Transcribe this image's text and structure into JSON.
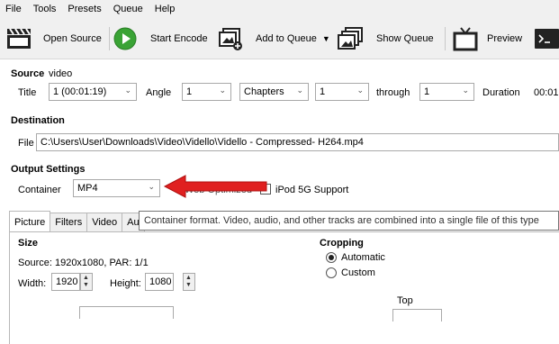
{
  "menu": [
    "File",
    "Tools",
    "Presets",
    "Queue",
    "Help"
  ],
  "toolbar": {
    "open_source": "Open Source",
    "start_encode": "Start Encode",
    "add_to_queue": "Add to Queue",
    "show_queue": "Show Queue",
    "preview": "Preview"
  },
  "source": {
    "label": "Source",
    "name": "video",
    "title_label": "Title",
    "title_value": "1 (00:01:19)",
    "angle_label": "Angle",
    "angle_value": "1",
    "chapters_value": "Chapters",
    "chapter_start": "1",
    "through_label": "through",
    "chapter_end": "1",
    "duration_label": "Duration",
    "duration_value": "00:01"
  },
  "destination": {
    "label": "Destination",
    "file_label": "File",
    "file_value": "C:\\Users\\User\\Downloads\\Video\\Vidello\\Vidello - Compressed- H264.mp4"
  },
  "output": {
    "label": "Output Settings",
    "container_label": "Container",
    "container_value": "MP4",
    "web_optimized": "Web Optimized",
    "ipod_support": "iPod 5G Support"
  },
  "tabs": [
    "Picture",
    "Filters",
    "Video",
    "Au"
  ],
  "tooltip": "Container format. Video, audio, and other tracks are combined into a single file of this type",
  "picture": {
    "size_label": "Size",
    "source_info": "Source:  1920x1080, PAR: 1/1",
    "width_label": "Width:",
    "width_value": "1920",
    "height_label": "Height:",
    "height_value": "1080",
    "cropping_label": "Cropping",
    "automatic": "Automatic",
    "custom": "Custom",
    "top_label": "Top"
  },
  "colors": {
    "play_green": "#3aa335",
    "arrow_red": "#e02020"
  },
  "icons": [
    "clapperboard-icon",
    "play-icon",
    "add-queue-icon",
    "show-queue-icon",
    "tv-icon",
    "terminal-icon"
  ]
}
